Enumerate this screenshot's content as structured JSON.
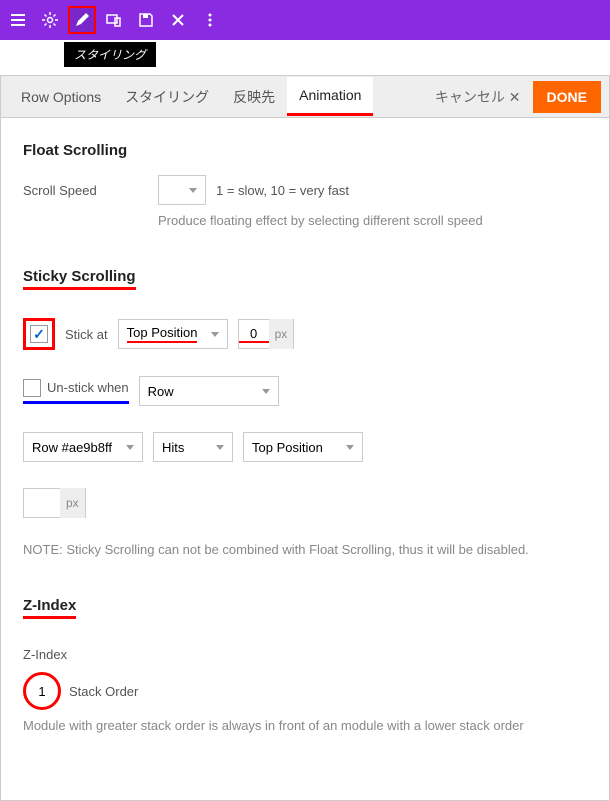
{
  "toolbar": {
    "tooltip": "スタイリング"
  },
  "tabs": {
    "row_options": "Row Options",
    "styling": "スタイリング",
    "reflect": "反映先",
    "animation": "Animation",
    "cancel": "キャンセル ✕",
    "done": "DONE"
  },
  "float": {
    "title": "Float Scrolling",
    "speed_label": "Scroll Speed",
    "speed_hint": "1 = slow, 10 = very fast",
    "desc": "Produce floating effect by selecting different scroll speed"
  },
  "sticky": {
    "title": "Sticky Scrolling",
    "stick_at": "Stick at",
    "position": "Top Position",
    "px_value": "0",
    "unit": "px",
    "unstick_label": "Un-stick when",
    "unstick_select": "Row",
    "row_select": "Row #ae9b8ff",
    "hits_select": "Hits",
    "pos_select": "Top Position",
    "unit2": "px",
    "note": "NOTE: Sticky Scrolling can not be combined with Float Scrolling, thus it will be disabled."
  },
  "zindex": {
    "title": "Z-Index",
    "label": "Z-Index",
    "value": "1",
    "stack": "Stack Order",
    "desc": "Module with greater stack order is always in front of an module with a lower stack order"
  }
}
